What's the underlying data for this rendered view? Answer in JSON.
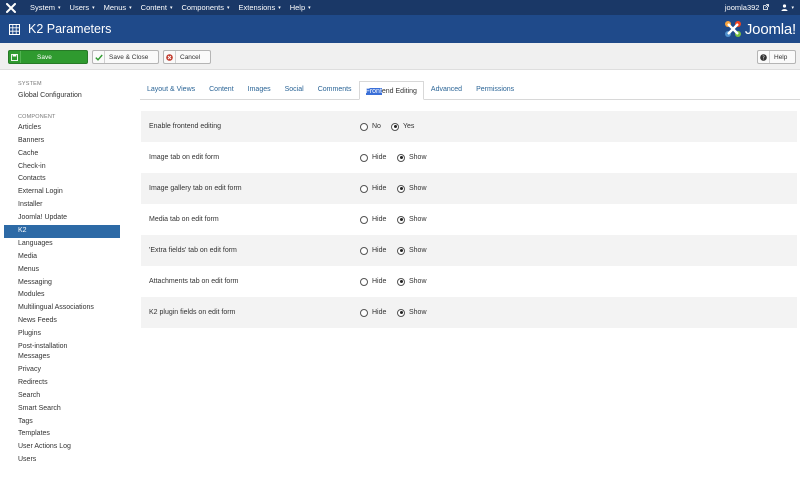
{
  "topnav": {
    "menu": [
      "System",
      "Users",
      "Menus",
      "Content",
      "Components",
      "Extensions",
      "Help"
    ],
    "username": "joomla392",
    "caret": "▾"
  },
  "titlebar": {
    "title": "K2 Parameters",
    "brand": "Joomla!"
  },
  "toolbar": {
    "save": "Save",
    "save_close": "Save & Close",
    "cancel": "Cancel",
    "help": "Help"
  },
  "sidebar": {
    "system_heading": "SYSTEM",
    "system_items": [
      "Global Configuration"
    ],
    "component_heading": "COMPONENT",
    "component_items": [
      "Articles",
      "Banners",
      "Cache",
      "Check-in",
      "Contacts",
      "External Login",
      "Installer",
      "Joomla! Update",
      "K2",
      "Languages",
      "Media",
      "Menus",
      "Messaging",
      "Modules",
      "Multilingual Associations",
      "News Feeds",
      "Plugins",
      "Post-installation Messages",
      "Privacy",
      "Redirects",
      "Search",
      "Smart Search",
      "Tags",
      "Templates",
      "User Actions Log",
      "Users"
    ],
    "active": "K2"
  },
  "tabs": {
    "items": [
      "Layout & Views",
      "Content",
      "Images",
      "Social",
      "Comments",
      "Frontend Editing",
      "Advanced",
      "Permissions"
    ],
    "active": "Frontend Editing",
    "active_highlight": "Front",
    "active_rest": "end Editing"
  },
  "form": {
    "rows": [
      {
        "label": "Enable frontend editing",
        "options": [
          "No",
          "Yes"
        ],
        "selected": "Yes"
      },
      {
        "label": "Image tab on edit form",
        "options": [
          "Hide",
          "Show"
        ],
        "selected": "Show"
      },
      {
        "label": "Image gallery tab on edit form",
        "options": [
          "Hide",
          "Show"
        ],
        "selected": "Show"
      },
      {
        "label": "Media tab on edit form",
        "options": [
          "Hide",
          "Show"
        ],
        "selected": "Show"
      },
      {
        "label": "'Extra fields' tab on edit form",
        "options": [
          "Hide",
          "Show"
        ],
        "selected": "Show"
      },
      {
        "label": "Attachments tab on edit form",
        "options": [
          "Hide",
          "Show"
        ],
        "selected": "Show"
      },
      {
        "label": "K2 plugin fields on edit form",
        "options": [
          "Hide",
          "Show"
        ],
        "selected": "Show"
      }
    ]
  },
  "colors": {
    "topnav_bg": "#1a3867",
    "titlebar_bg": "#1f4a8a",
    "save_green": "#2f9a2f",
    "active_blue": "#2d6aa6",
    "link_blue": "#2a6496"
  }
}
